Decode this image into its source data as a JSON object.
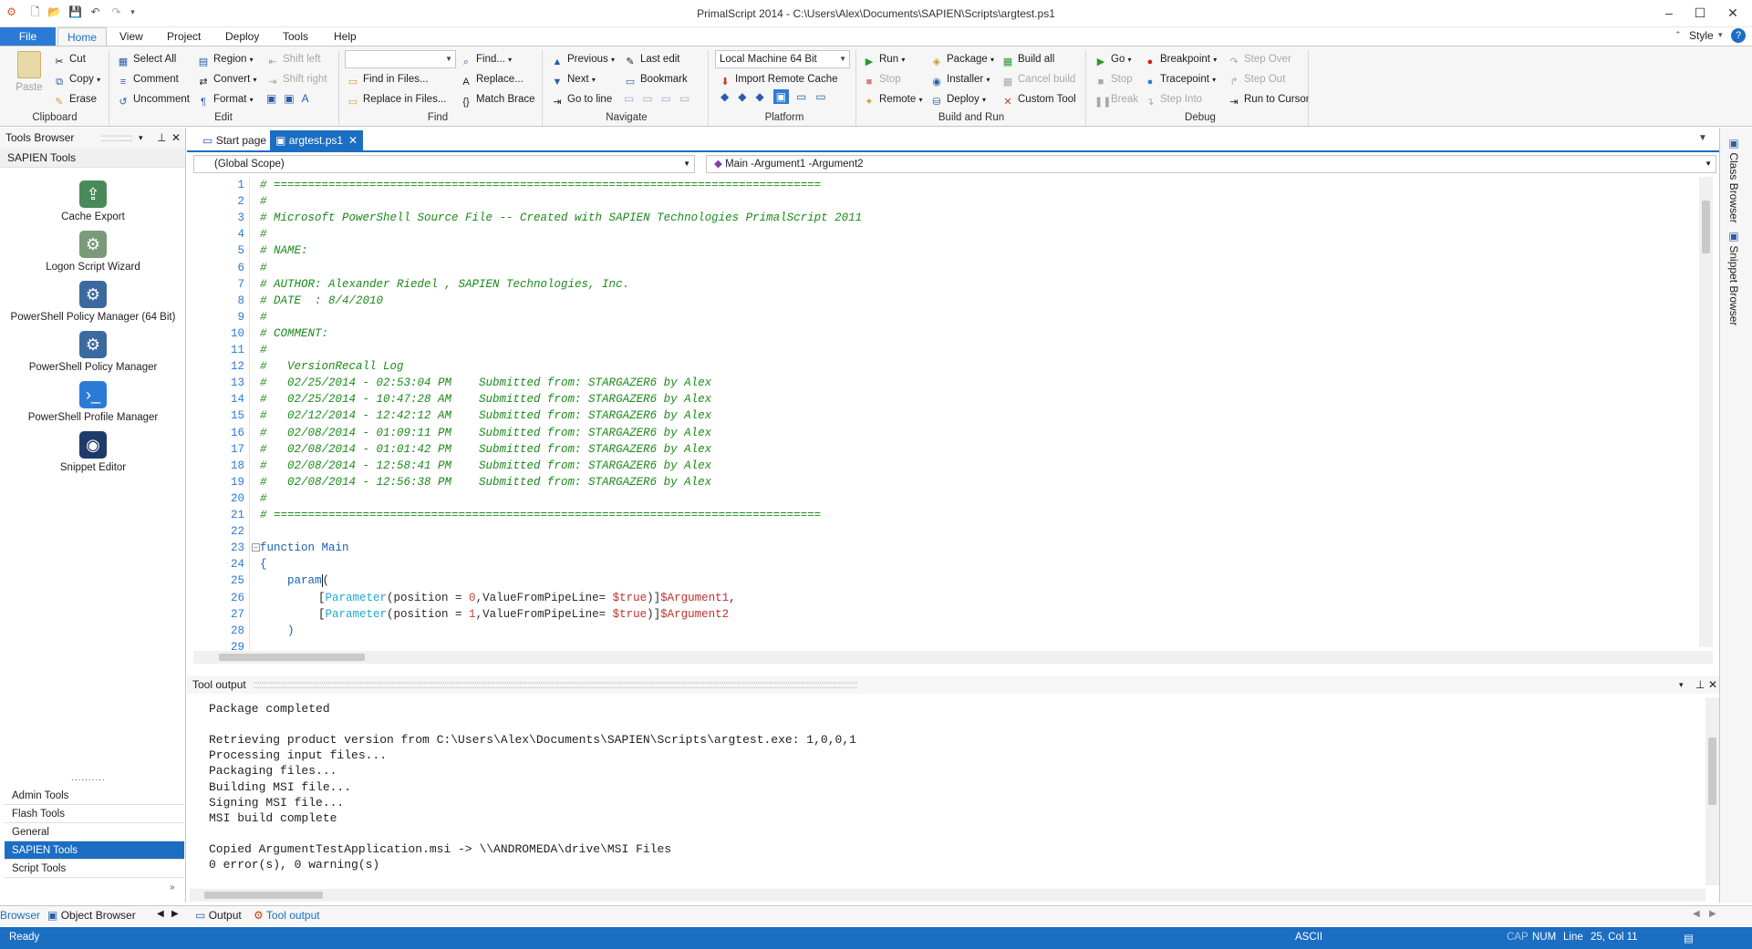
{
  "window": {
    "title": "PrimalScript 2014 - C:\\Users\\Alex\\Documents\\SAPIEN\\Scripts\\argtest.ps1",
    "style_label": "Style"
  },
  "ribbon_tabs": [
    "File",
    "Home",
    "View",
    "Project",
    "Deploy",
    "Tools",
    "Help"
  ],
  "ribbon": {
    "clipboard": {
      "paste": "Paste",
      "cut": "Cut",
      "copy": "Copy",
      "erase": "Erase",
      "group": "Clipboard"
    },
    "edit": {
      "select_all": "Select All",
      "comment": "Comment",
      "uncomment": "Uncomment",
      "region": "Region",
      "convert": "Convert",
      "format": "Format",
      "shift_left": "Shift left",
      "shift_right": "Shift right",
      "group": "Edit"
    },
    "find": {
      "find": "Find...",
      "find_in_files": "Find in Files...",
      "replace": "Replace...",
      "replace_in_files": "Replace in Files...",
      "match_brace": "Match Brace",
      "group": "Find"
    },
    "navigate": {
      "previous": "Previous",
      "next": "Next",
      "go_to_line": "Go to line",
      "last_edit": "Last edit",
      "bookmark": "Bookmark",
      "group": "Navigate"
    },
    "platform": {
      "machine": "Local Machine 64 Bit",
      "import_remote_cache": "Import Remote Cache",
      "group": "Platform"
    },
    "build": {
      "run": "Run",
      "stop": "Stop",
      "remote": "Remote",
      "package": "Package",
      "installer": "Installer",
      "deploy": "Deploy",
      "build_all": "Build all",
      "cancel_build": "Cancel build",
      "custom_tool": "Custom Tool",
      "group": "Build and Run"
    },
    "debug": {
      "go": "Go",
      "stop": "Stop",
      "break": "Break",
      "breakpoint": "Breakpoint",
      "tracepoint": "Tracepoint",
      "step_into": "Step Into",
      "step_over": "Step Over",
      "step_out": "Step Out",
      "run_to_cursor": "Run to Cursor",
      "group": "Debug"
    }
  },
  "tools_browser": {
    "title": "Tools Browser",
    "section": "SAPIEN Tools",
    "items": [
      "Cache Export",
      "Logon Script Wizard",
      "PowerShell Policy Manager (64 Bit)",
      "PowerShell Policy Manager",
      "PowerShell Profile Manager",
      "Snippet Editor"
    ],
    "grip": "..........",
    "categories": [
      "Admin Tools",
      "Flash Tools",
      "General",
      "SAPIEN Tools",
      "Script Tools"
    ],
    "selected_category": "SAPIEN Tools"
  },
  "doc_tabs": {
    "start_page": "Start page",
    "active": "argtest.ps1"
  },
  "scope": {
    "left": "(Global Scope)",
    "right": "Main -Argument1 -Argument2"
  },
  "editor": {
    "line_numbers": [
      "1",
      "2",
      "3",
      "4",
      "5",
      "6",
      "7",
      "8",
      "9",
      "10",
      "11",
      "12",
      "13",
      "14",
      "15",
      "16",
      "17",
      "18",
      "19",
      "20",
      "21",
      "22",
      "23",
      "24",
      "25",
      "26",
      "27",
      "28",
      "29"
    ],
    "comment_lines": [
      "# ================================================================================",
      "#",
      "# Microsoft PowerShell Source File -- Created with SAPIEN Technologies PrimalScript 2011",
      "#",
      "# NAME:",
      "#",
      "# AUTHOR: Alexander Riedel , SAPIEN Technologies, Inc.",
      "# DATE  : 8/4/2010",
      "#",
      "# COMMENT:",
      "#",
      "#   VersionRecall Log",
      "#   02/25/2014 - 02:53:04 PM    Submitted from: STARGAZER6 by Alex",
      "#   02/25/2014 - 10:47:28 AM    Submitted from: STARGAZER6 by Alex",
      "#   02/12/2014 - 12:42:12 AM    Submitted from: STARGAZER6 by Alex",
      "#   02/08/2014 - 01:09:11 PM    Submitted from: STARGAZER6 by Alex",
      "#   02/08/2014 - 01:01:42 PM    Submitted from: STARGAZER6 by Alex",
      "#   02/08/2014 - 12:58:41 PM    Submitted from: STARGAZER6 by Alex",
      "#   02/08/2014 - 12:56:38 PM    Submitted from: STARGAZER6 by Alex",
      "#",
      "# ================================================================================"
    ],
    "func_kw": "function",
    "func_name": "Main",
    "brace_open": "{",
    "param_kw": "param",
    "param_paren": "(",
    "p1": {
      "attr": "Parameter",
      "pre": "(position = ",
      "num": "0",
      "mid": ",ValueFromPipeLine= ",
      "val": "$true",
      "post": ")]",
      "var": "$Argument1",
      "tail": ","
    },
    "p2": {
      "attr": "Parameter",
      "pre": "(position = ",
      "num": "1",
      "mid": ",ValueFromPipeLine= ",
      "val": "$true",
      "post": ")]",
      "var": "$Argument2",
      "tail": ""
    },
    "close_paren": ")"
  },
  "tool_output": {
    "title": "Tool output",
    "lines": [
      "Package completed",
      "",
      "Retrieving product version from C:\\Users\\Alex\\Documents\\SAPIEN\\Scripts\\argtest.exe: 1,0,0,1",
      "Processing input files...",
      "Packaging files...",
      "Building MSI file...",
      "Signing MSI file...",
      "MSI build complete",
      "",
      "Copied ArgumentTestApplication.msi -> \\\\ANDROMEDA\\drive\\MSI Files",
      "0 error(s), 0 warning(s)"
    ]
  },
  "bottom_tabs": {
    "browser": "Browser",
    "object_browser": "Object Browser",
    "output": "Output",
    "tool_output": "Tool output"
  },
  "side_panels": {
    "class_browser": "Class Browser",
    "snippet_browser": "Snippet Browser"
  },
  "status": {
    "ready": "Ready",
    "encoding": "ASCII",
    "cap": "CAP",
    "num": "NUM",
    "line_label": "Line",
    "position": "25, Col  11"
  },
  "colors": {
    "accent": "#1b6ec2",
    "comment": "#1a8a1a",
    "keyword": "#1b5fb5"
  }
}
